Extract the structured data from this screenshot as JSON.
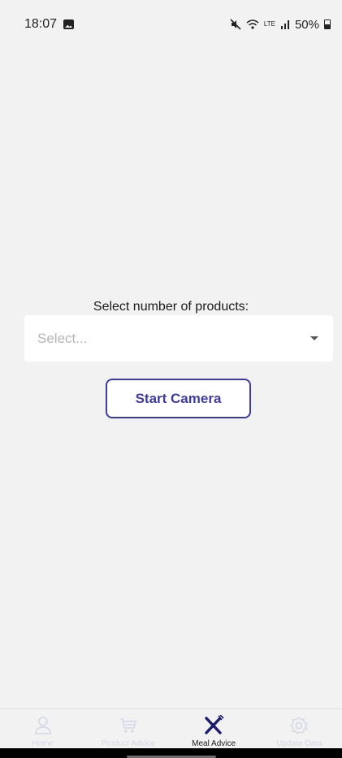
{
  "status_bar": {
    "time": "18:07",
    "network_label": "LTE",
    "battery": "50%"
  },
  "main": {
    "prompt": "Select number of products:",
    "select": {
      "value": "Select..."
    },
    "start_camera_label": "Start Camera"
  },
  "nav": {
    "active_color": "#1a1a6e",
    "inactive_color": "#d3d7e6",
    "items": [
      {
        "label": "Home",
        "icon": "person-icon"
      },
      {
        "label": "Product Advice",
        "icon": "cart-icon"
      },
      {
        "label": "Meal Advice",
        "icon": "utensils-icon"
      },
      {
        "label": "Update Data",
        "icon": "gear-icon"
      }
    ],
    "active_index": 2
  },
  "colors": {
    "accent": "#3d3aa8",
    "background": "#f2f2f2"
  }
}
